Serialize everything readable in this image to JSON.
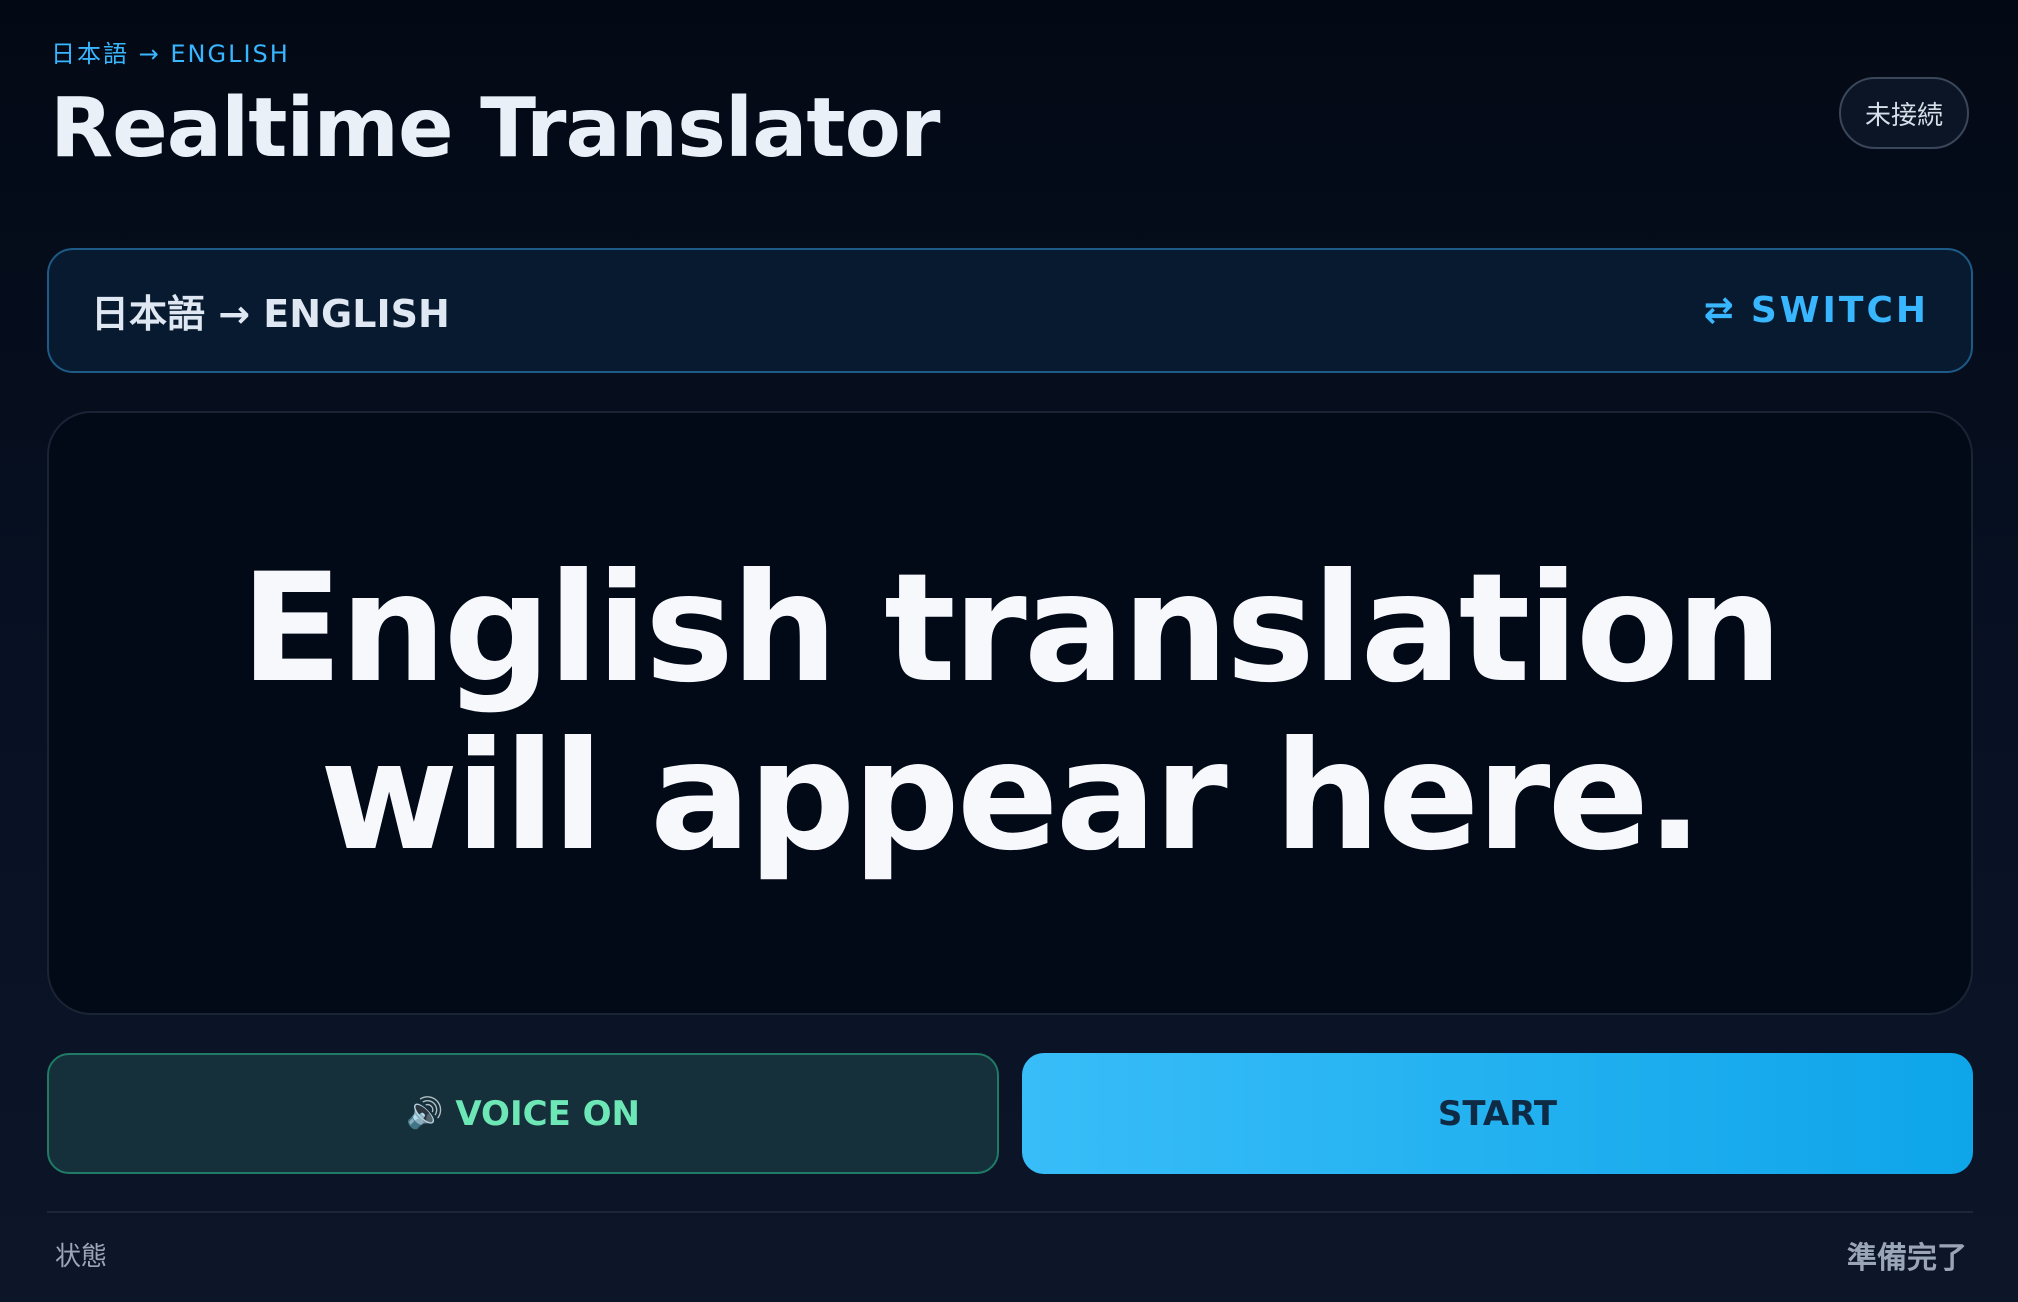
{
  "header": {
    "eyebrow": "日本語 → ENGLISH",
    "title": "Realtime Translator",
    "connection_status": "未接続"
  },
  "language_bar": {
    "pair": "日本語 → ENGLISH",
    "switch_icon": "⇄",
    "switch_label": "SWITCH"
  },
  "output": {
    "placeholder": "English translation will appear here."
  },
  "controls": {
    "voice_icon": "🔊",
    "voice_label": "VOICE ON",
    "start_label": "START"
  },
  "footer": {
    "status_label": "状態",
    "status_value": "準備完了"
  },
  "colors": {
    "accent": "#38b6ff",
    "voice_green": "#6ee7b7",
    "start_gradient_from": "#38bdf8",
    "start_gradient_to": "#0ea5e9",
    "background": "#030914"
  }
}
